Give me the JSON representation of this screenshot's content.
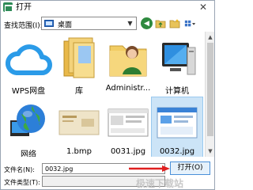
{
  "window": {
    "title": "打开",
    "close_label": "✕"
  },
  "lookin": {
    "label": "查找范围(I):",
    "value": "桌面"
  },
  "items": [
    {
      "name": "WPS网盘"
    },
    {
      "name": "库"
    },
    {
      "name": "Administr..."
    },
    {
      "name": "计算机"
    },
    {
      "name": "网络"
    },
    {
      "name": "1.bmp"
    },
    {
      "name": "0031.jpg"
    },
    {
      "name": "0032.jpg"
    }
  ],
  "filename": {
    "label": "文件名(N):",
    "value": "0032.jpg"
  },
  "filetype": {
    "label": "文件类型(T):"
  },
  "open_button": {
    "label": "打开(O)"
  },
  "watermark": {
    "text": "极速下载站"
  },
  "colors": {
    "selection": "#cce4f7",
    "accent": "#2b6cc4",
    "arrow": "#e02020"
  }
}
